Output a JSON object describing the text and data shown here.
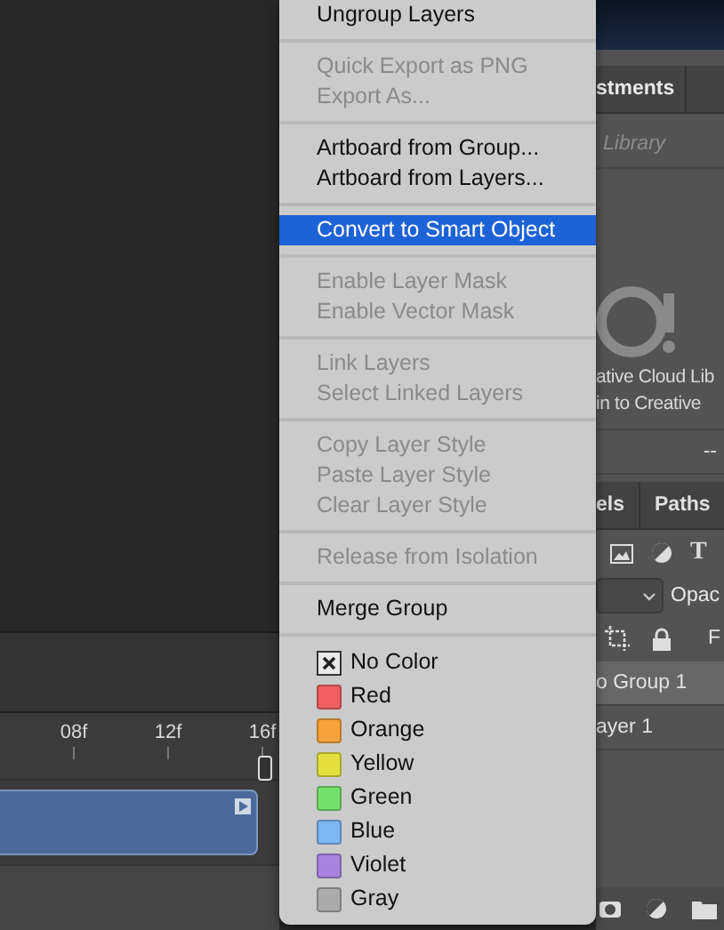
{
  "timeline": {
    "ticks": [
      "08f",
      "12f",
      "16f"
    ]
  },
  "menu": {
    "items": [
      {
        "kind": "item",
        "label": "Ungroup Layers",
        "disabled": false,
        "selected": false
      },
      {
        "kind": "separator"
      },
      {
        "kind": "item",
        "label": "Quick Export as PNG",
        "disabled": true,
        "selected": false
      },
      {
        "kind": "item",
        "label": "Export As...",
        "disabled": true,
        "selected": false
      },
      {
        "kind": "separator"
      },
      {
        "kind": "item",
        "label": "Artboard from Group...",
        "disabled": false,
        "selected": false
      },
      {
        "kind": "item",
        "label": "Artboard from Layers...",
        "disabled": false,
        "selected": false
      },
      {
        "kind": "separator"
      },
      {
        "kind": "item",
        "label": "Convert to Smart Object",
        "disabled": false,
        "selected": true
      },
      {
        "kind": "separator"
      },
      {
        "kind": "item",
        "label": "Enable Layer Mask",
        "disabled": true,
        "selected": false
      },
      {
        "kind": "item",
        "label": "Enable Vector Mask",
        "disabled": true,
        "selected": false
      },
      {
        "kind": "separator"
      },
      {
        "kind": "item",
        "label": "Link Layers",
        "disabled": true,
        "selected": false
      },
      {
        "kind": "item",
        "label": "Select Linked Layers",
        "disabled": true,
        "selected": false
      },
      {
        "kind": "separator"
      },
      {
        "kind": "item",
        "label": "Copy Layer Style",
        "disabled": true,
        "selected": false
      },
      {
        "kind": "item",
        "label": "Paste Layer Style",
        "disabled": true,
        "selected": false
      },
      {
        "kind": "item",
        "label": "Clear Layer Style",
        "disabled": true,
        "selected": false
      },
      {
        "kind": "separator"
      },
      {
        "kind": "item",
        "label": "Release from Isolation",
        "disabled": true,
        "selected": false
      },
      {
        "kind": "separator"
      },
      {
        "kind": "item",
        "label": "Merge Group",
        "disabled": false,
        "selected": false
      },
      {
        "kind": "separator"
      },
      {
        "kind": "none",
        "label": "No Color"
      },
      {
        "kind": "color",
        "label": "Red",
        "color": "#f25f5f"
      },
      {
        "kind": "color",
        "label": "Orange",
        "color": "#f7a13a"
      },
      {
        "kind": "color",
        "label": "Yellow",
        "color": "#e3df3c"
      },
      {
        "kind": "color",
        "label": "Green",
        "color": "#74e06c"
      },
      {
        "kind": "color",
        "label": "Blue",
        "color": "#7fb6f5"
      },
      {
        "kind": "color",
        "label": "Violet",
        "color": "#a884e0"
      },
      {
        "kind": "color",
        "label": "Gray",
        "color": "#ababab"
      }
    ]
  },
  "right_panel": {
    "tab": "stments",
    "library_placeholder": "Library",
    "cloud_lines": [
      "ative Cloud Lib",
      "in to Creative"
    ],
    "status": "--",
    "tabs": [
      "els",
      "Paths"
    ],
    "type_glyph": "T",
    "opacity_label": "Opac",
    "fill_label": "F",
    "layers": [
      {
        "name": "o Group 1",
        "selected": true
      },
      {
        "name": "ayer 1",
        "selected": false
      }
    ]
  }
}
